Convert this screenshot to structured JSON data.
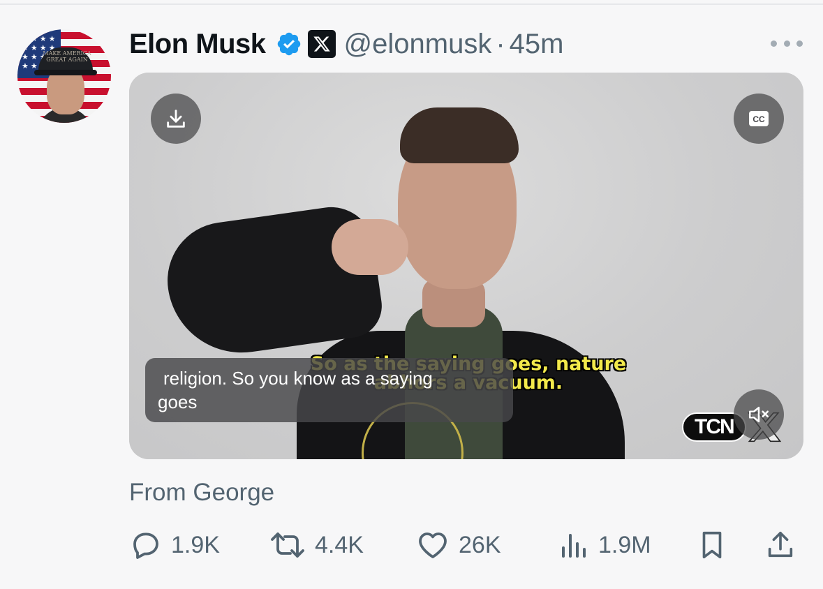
{
  "post": {
    "author_name": "Elon Musk",
    "handle": "@elonmusk",
    "separator": "·",
    "time": "45m",
    "text": "From George",
    "avatar_hat_text": "MAKE AMERICA GREAT AGAIN"
  },
  "video": {
    "burned_subtitle_line1": "So as the saying goes, nature",
    "burned_subtitle_line2": "abhors a vacuum.",
    "caption_line1": "religion. So you know as a saying",
    "caption_line2": "goes",
    "watermark": "TCN",
    "cc_label": "CC"
  },
  "actions": {
    "replies": "1.9K",
    "reposts": "4.4K",
    "likes": "26K",
    "views": "1.9M"
  },
  "colors": {
    "verified_blue": "#1d9bf0",
    "secondary_text": "#536471",
    "subtitle_yellow": "#f2e94b"
  },
  "icons": [
    "verified-badge-icon",
    "x-logo-icon",
    "more-icon",
    "download-icon",
    "cc-icon",
    "mute-icon",
    "reply-icon",
    "repost-icon",
    "like-icon",
    "views-icon",
    "bookmark-icon",
    "share-icon"
  ]
}
